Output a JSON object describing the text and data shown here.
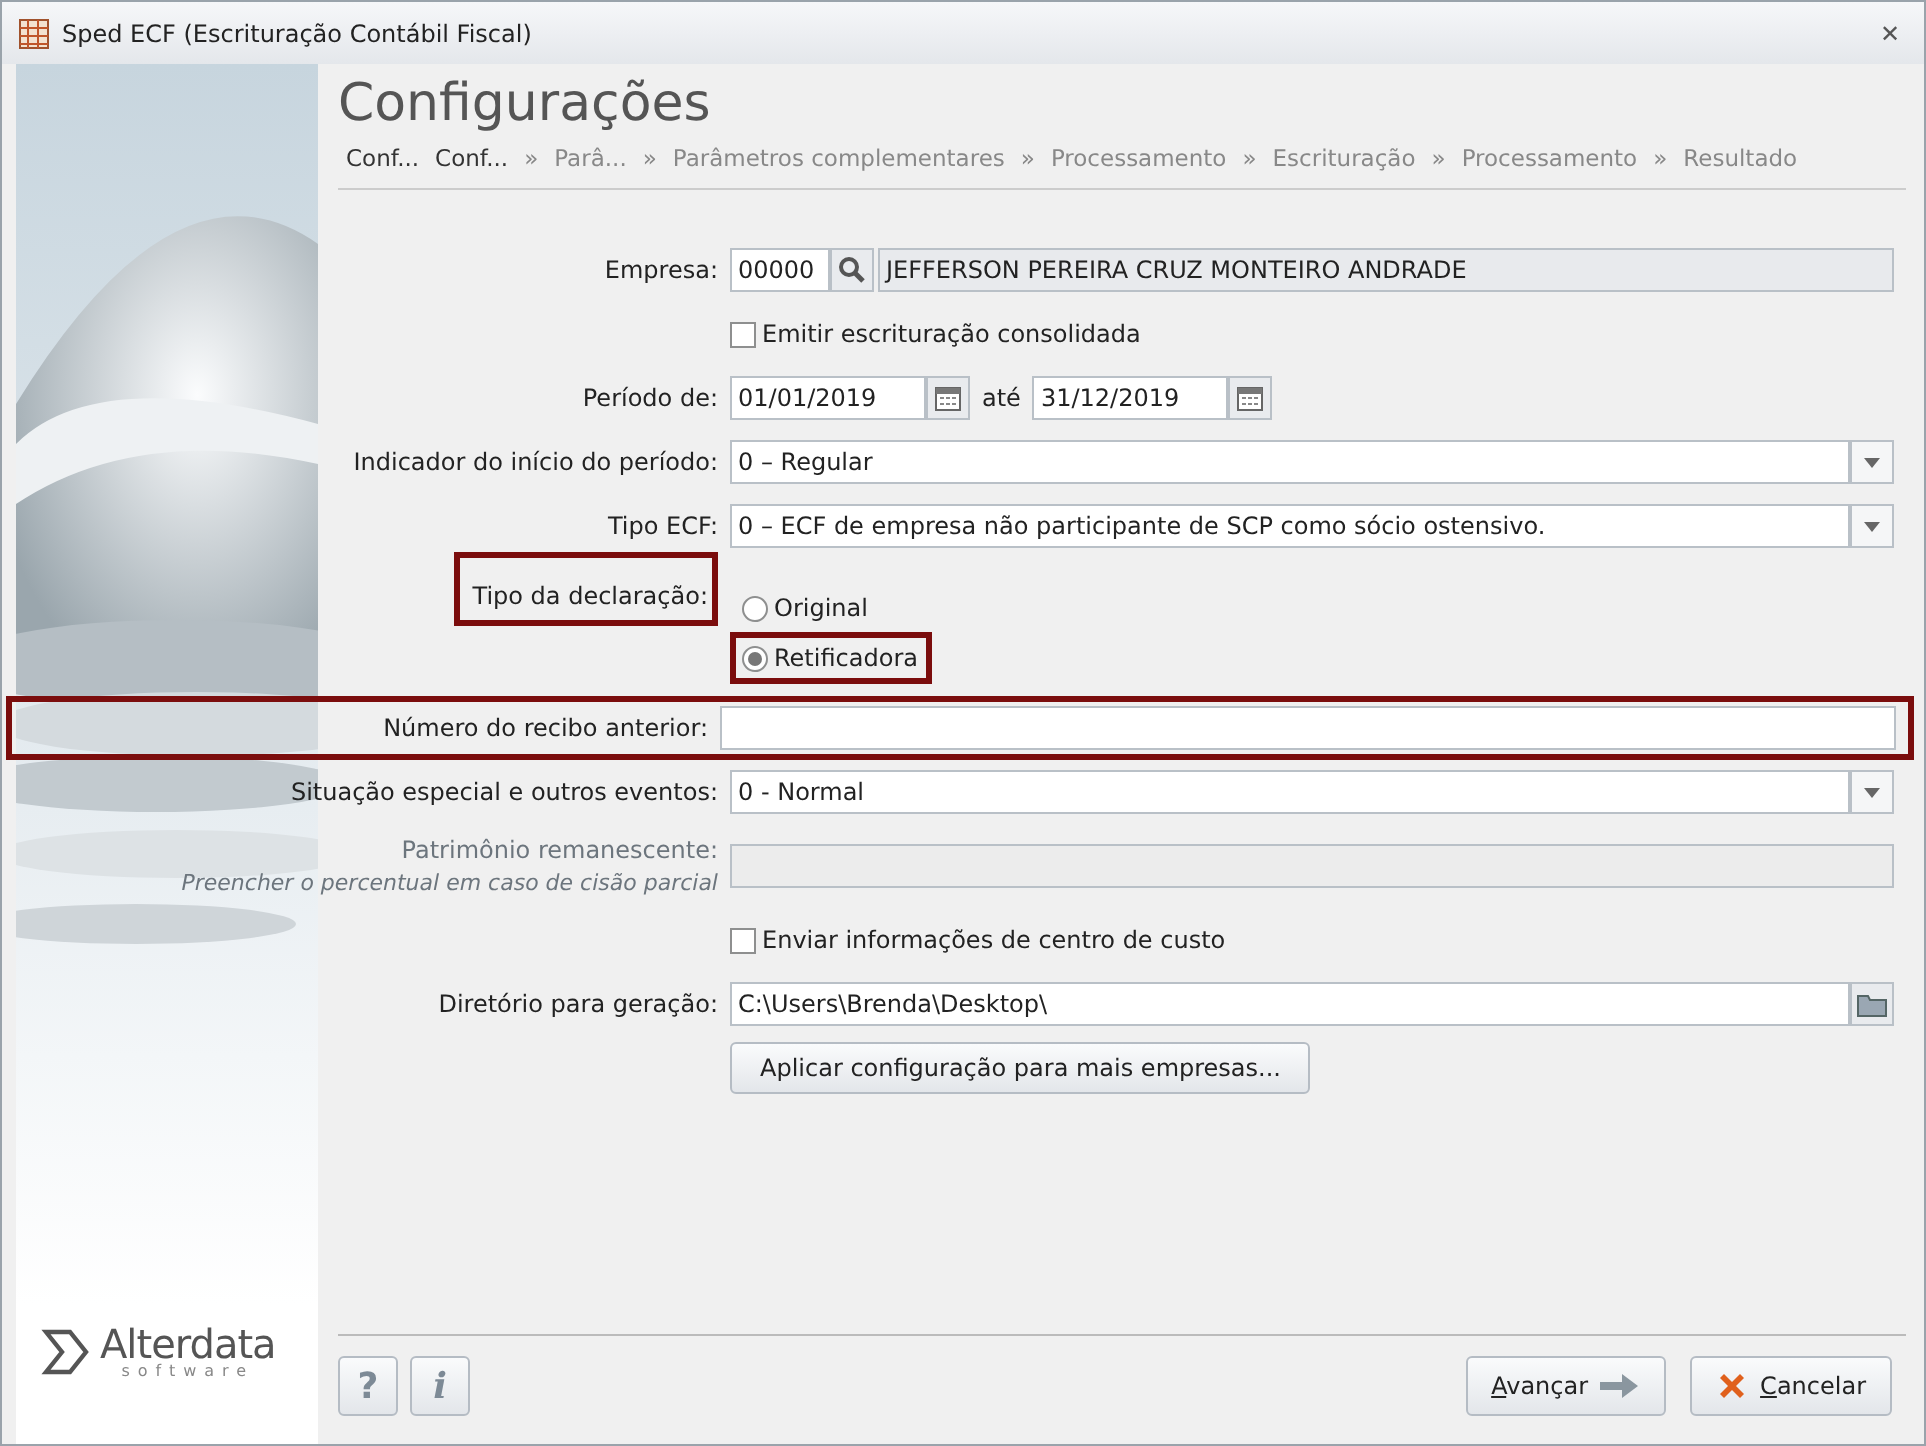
{
  "window": {
    "title": "Sped ECF (Escrituração Contábil Fiscal)",
    "close": "✕"
  },
  "header": {
    "title": "Configurações",
    "steps": [
      {
        "label": "Conf...",
        "done": true
      },
      {
        "label": "Conf...",
        "done": true
      },
      {
        "label": "Parâ...",
        "separator": "»",
        "done": false
      },
      {
        "label": "Parâmetros complementares",
        "separator": "»",
        "done": false
      },
      {
        "label": "Processamento",
        "separator": "»",
        "done": false
      },
      {
        "label": "Escrituração",
        "separator": "»",
        "done": false
      },
      {
        "label": "Processamento",
        "separator": "»",
        "done": false
      },
      {
        "label": "Resultado",
        "separator": "»",
        "done": false
      }
    ]
  },
  "form": {
    "rows": [
      {
        "kind": "lookup",
        "label": "Empresa:",
        "code": "00000",
        "name": "JEFFERSON PEREIRA CRUZ MONTEIRO ANDRADE"
      },
      {
        "kind": "checkbox",
        "text": "Emitir escrituração consolidada",
        "checked": false
      },
      {
        "kind": "daterange",
        "label": "Período de:",
        "from": "01/01/2019",
        "between": "até",
        "to": "31/12/2019"
      },
      {
        "kind": "select",
        "label": "Indicador do início do período:",
        "value": "0 – Regular"
      },
      {
        "kind": "select",
        "label": "Tipo ECF:",
        "value": "0  – ECF de empresa não participante de SCP como sócio ostensivo."
      },
      {
        "kind": "radio",
        "label": "Tipo da declaração:",
        "highlighted": true,
        "options": [
          {
            "text": "Original",
            "selected": false,
            "highlighted": false
          },
          {
            "text": "Retificadora",
            "selected": true,
            "highlighted": true
          }
        ]
      },
      {
        "kind": "text",
        "label": "Número do recibo anterior:",
        "value": "",
        "highlighted": true
      },
      {
        "kind": "select",
        "label": "Situação especial e outros eventos:",
        "value": "0 - Normal"
      },
      {
        "kind": "disabled",
        "label": "Patrimônio remanescente:",
        "hint": "Preencher o percentual em caso de cisão parcial"
      },
      {
        "kind": "checkbox",
        "text": "Enviar informações de centro de custo",
        "checked": false
      },
      {
        "kind": "folder",
        "label": "Diretório para geração:",
        "value": "C:\\Users\\Brenda\\Desktop\\"
      },
      {
        "kind": "button",
        "text": "Aplicar configuração para mais empresas..."
      }
    ]
  },
  "logo": {
    "name": "Alterdata",
    "tagline": "software"
  },
  "footer": {
    "help": "?",
    "info": "i",
    "next": "Avançar",
    "cancel": "Cancelar"
  }
}
